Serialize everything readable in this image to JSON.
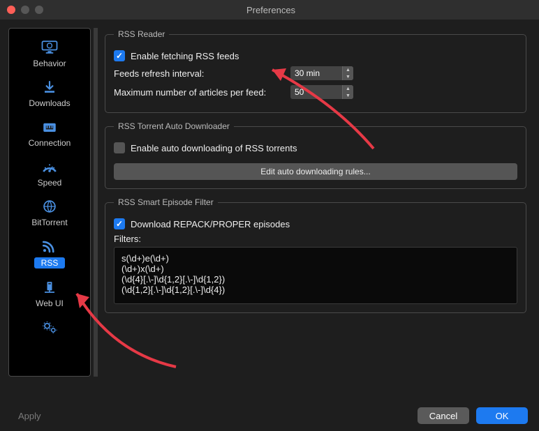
{
  "window": {
    "title": "Preferences"
  },
  "sidebar": {
    "items": [
      {
        "label": "Behavior",
        "icon": "behavior"
      },
      {
        "label": "Downloads",
        "icon": "downloads"
      },
      {
        "label": "Connection",
        "icon": "connection"
      },
      {
        "label": "Speed",
        "icon": "speed"
      },
      {
        "label": "BitTorrent",
        "icon": "globe"
      },
      {
        "label": "RSS",
        "icon": "rss",
        "selected": true
      },
      {
        "label": "Web UI",
        "icon": "webui"
      },
      {
        "label": "",
        "icon": "advanced"
      }
    ]
  },
  "rssReader": {
    "legend": "RSS Reader",
    "enable_label": "Enable fetching RSS feeds",
    "enable_checked": true,
    "refresh_label": "Feeds refresh interval:",
    "refresh_value": "30 min",
    "max_label": "Maximum number of articles per feed:",
    "max_value": "50"
  },
  "autoDownloader": {
    "legend": "RSS Torrent Auto Downloader",
    "enable_label": "Enable auto downloading of RSS torrents",
    "enable_checked": false,
    "rules_button": "Edit auto downloading rules..."
  },
  "episodeFilter": {
    "legend": "RSS Smart Episode Filter",
    "repack_label": "Download REPACK/PROPER episodes",
    "repack_checked": true,
    "filters_label": "Filters:",
    "filters_text": "s(\\d+)e(\\d+)\n(\\d+)x(\\d+)\n(\\d{4}[.\\-]\\d{1,2}[.\\-]\\d{1,2})\n(\\d{1,2}[.\\-]\\d{1,2}[.\\-]\\d{4})"
  },
  "footer": {
    "apply": "Apply",
    "cancel": "Cancel",
    "ok": "OK"
  },
  "annotations": {
    "arrow_color": "#e63946"
  }
}
